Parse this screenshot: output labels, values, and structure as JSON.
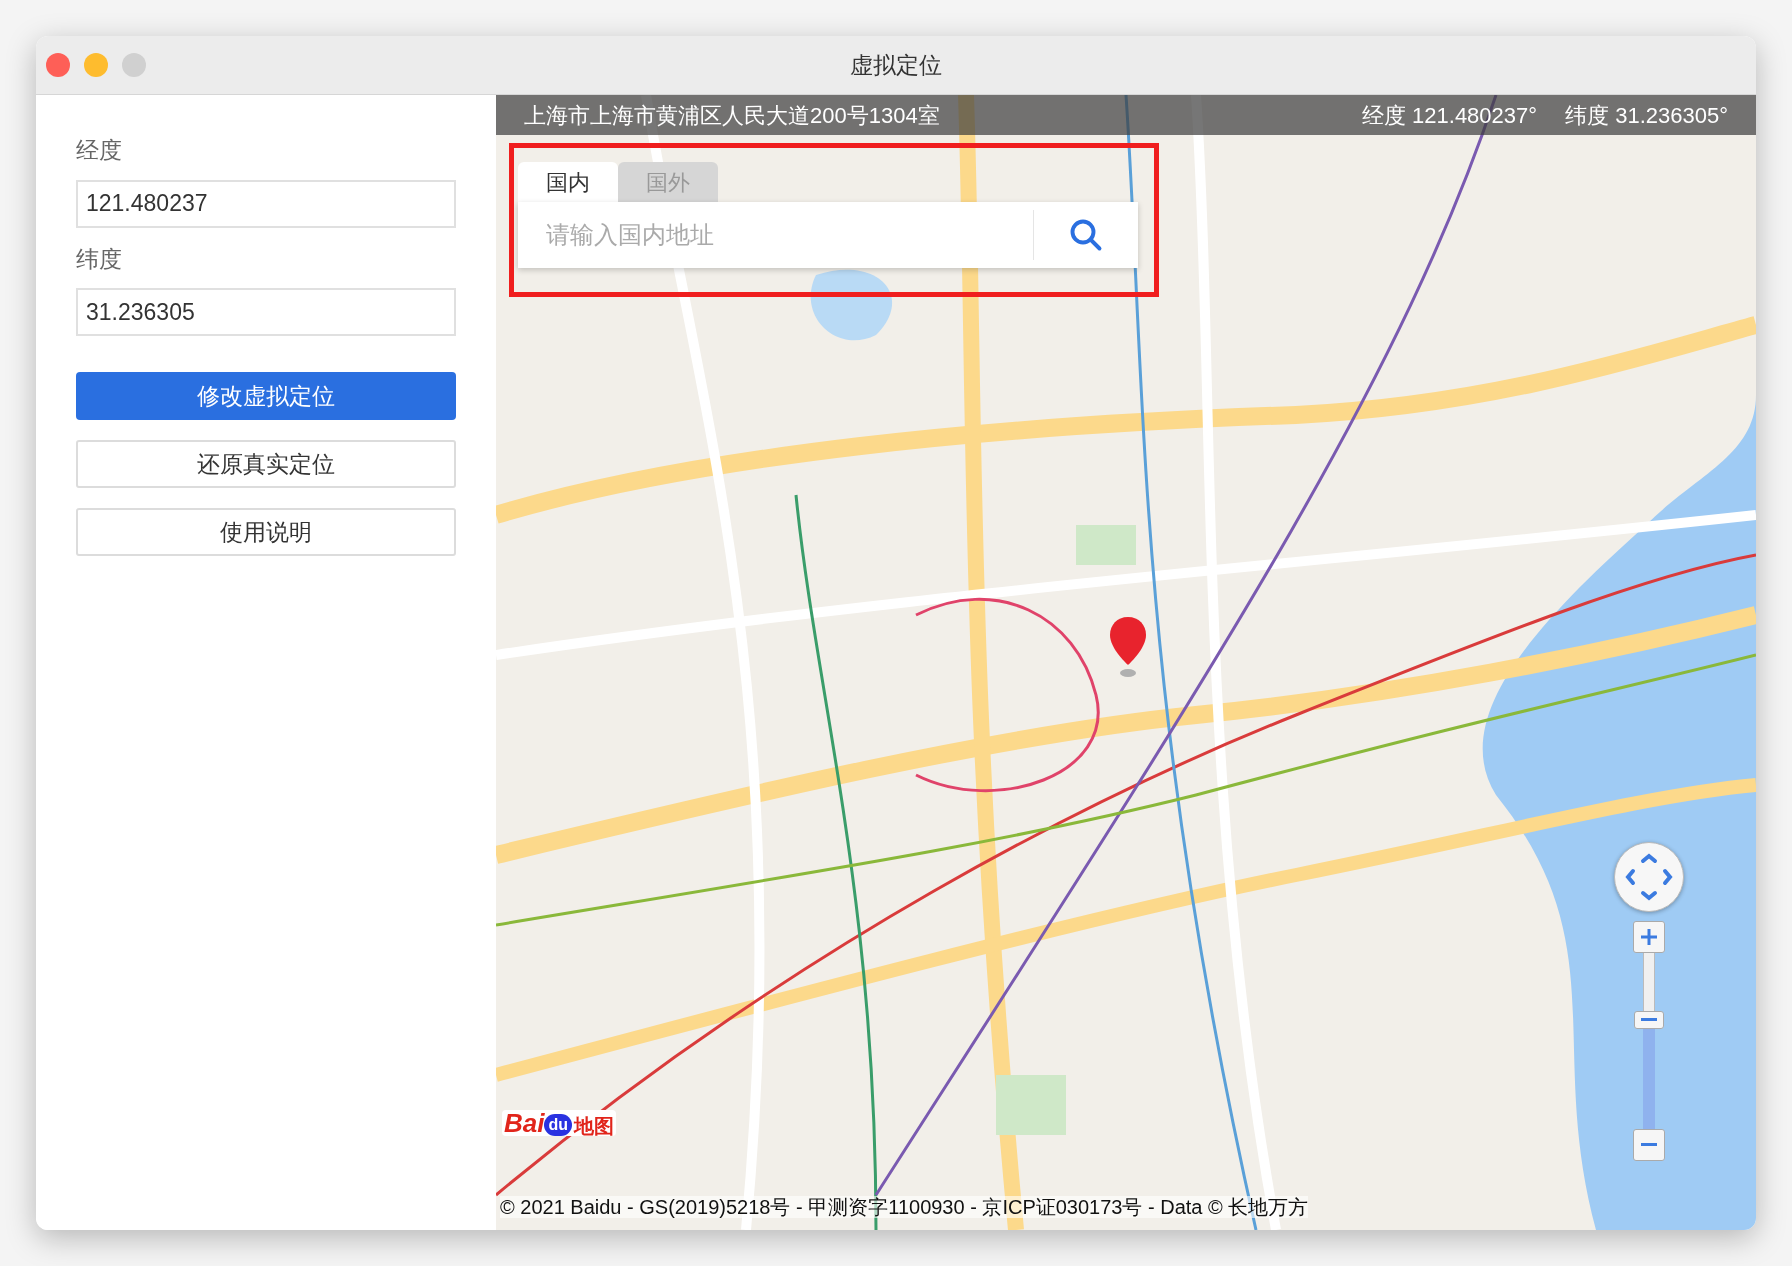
{
  "window": {
    "title": "虚拟定位"
  },
  "form": {
    "fields": [
      {
        "label": "经度",
        "value": "121.480237"
      },
      {
        "label": "纬度",
        "value": "31.236305"
      }
    ],
    "buttons": [
      {
        "label": "修改虚拟定位",
        "kind": "primary"
      },
      {
        "label": "还原真实定位",
        "kind": "default"
      },
      {
        "label": "使用说明",
        "kind": "default"
      }
    ]
  },
  "map": {
    "address": "上海市上海市黄浦区人民大道200号1304室",
    "longitude": "经度 121.480237°",
    "latitude": "纬度 31.236305°",
    "tabs": [
      {
        "label": "国内",
        "selected": true
      },
      {
        "label": "国外",
        "selected": false
      }
    ],
    "search": {
      "placeholder": "请输入国内地址"
    },
    "zoom": {
      "level": 0.62
    },
    "logo": [
      "Bai",
      "du",
      "地图"
    ],
    "copyright": "© 2021 Baidu - GS(2019)5218号 - 甲测资字1100930 - 京ICP证030173号 - Data © 长地万方"
  }
}
